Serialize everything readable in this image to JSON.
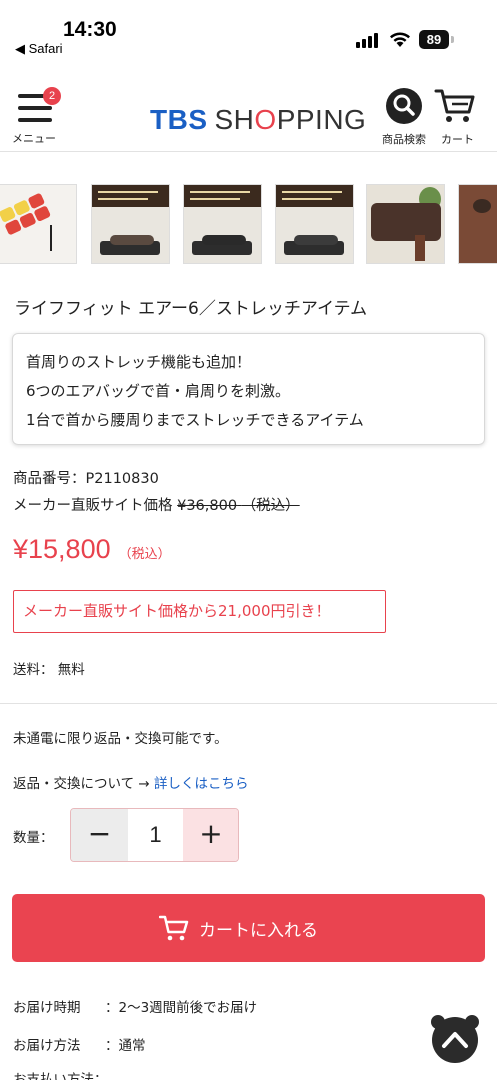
{
  "status_bar": {
    "time": "14:30",
    "back_app": "◀ Safari",
    "battery": "89"
  },
  "header": {
    "menu_badge": "2",
    "menu_label": "メニュー",
    "logo_tbs": "TBS",
    "logo_rest_1": "SH",
    "logo_o": "O",
    "logo_rest_2": "PPING",
    "search_label": "商品検索",
    "cart_label": "カート"
  },
  "thumbnails": [
    {
      "name": "thumb-mat-diagram"
    },
    {
      "name": "thumb-neck-stretch"
    },
    {
      "name": "thumb-back-stretch"
    },
    {
      "name": "thumb-waist-stretch"
    },
    {
      "name": "thumb-sofa-room"
    },
    {
      "name": "thumb-closeup"
    }
  ],
  "product": {
    "title": "ライフフィット エアー6／ストレッチアイテム",
    "features": [
      "首周りのストレッチ機能も追加！",
      "6つのエアバッグで首・肩周りを刺激。",
      "1台で首から腰周りまでストレッチできるアイテム"
    ],
    "code_label": "商品番号：",
    "code": "P2110830",
    "maker_price_label": "メーカー直販サイト価格",
    "maker_price": "¥36,800",
    "maker_price_tax": "（税込）",
    "sale_price": "¥15,800",
    "sale_tax": "（税込）",
    "discount_text": "メーカー直販サイト価格から21,000円引き！",
    "shipping": "送料： 無料"
  },
  "returns": {
    "note": "未通電に限り返品・交換可能です。",
    "link_prefix": "返品・交換について → ",
    "link_text": "詳しくはこちら"
  },
  "quantity": {
    "label": "数量：",
    "minus": "−",
    "value": "1",
    "plus": "+"
  },
  "add_to_cart": {
    "label": "カートに入れる"
  },
  "delivery": {
    "time_label": "お届け時期",
    "time_value": "：2〜3週間前後でお届け",
    "method_label": "お届け方法",
    "method_value": "：通常",
    "payment_label": "お支払い方法："
  },
  "colors": {
    "accent_red": "#ea4450",
    "brand_blue": "#1a5fc4"
  }
}
